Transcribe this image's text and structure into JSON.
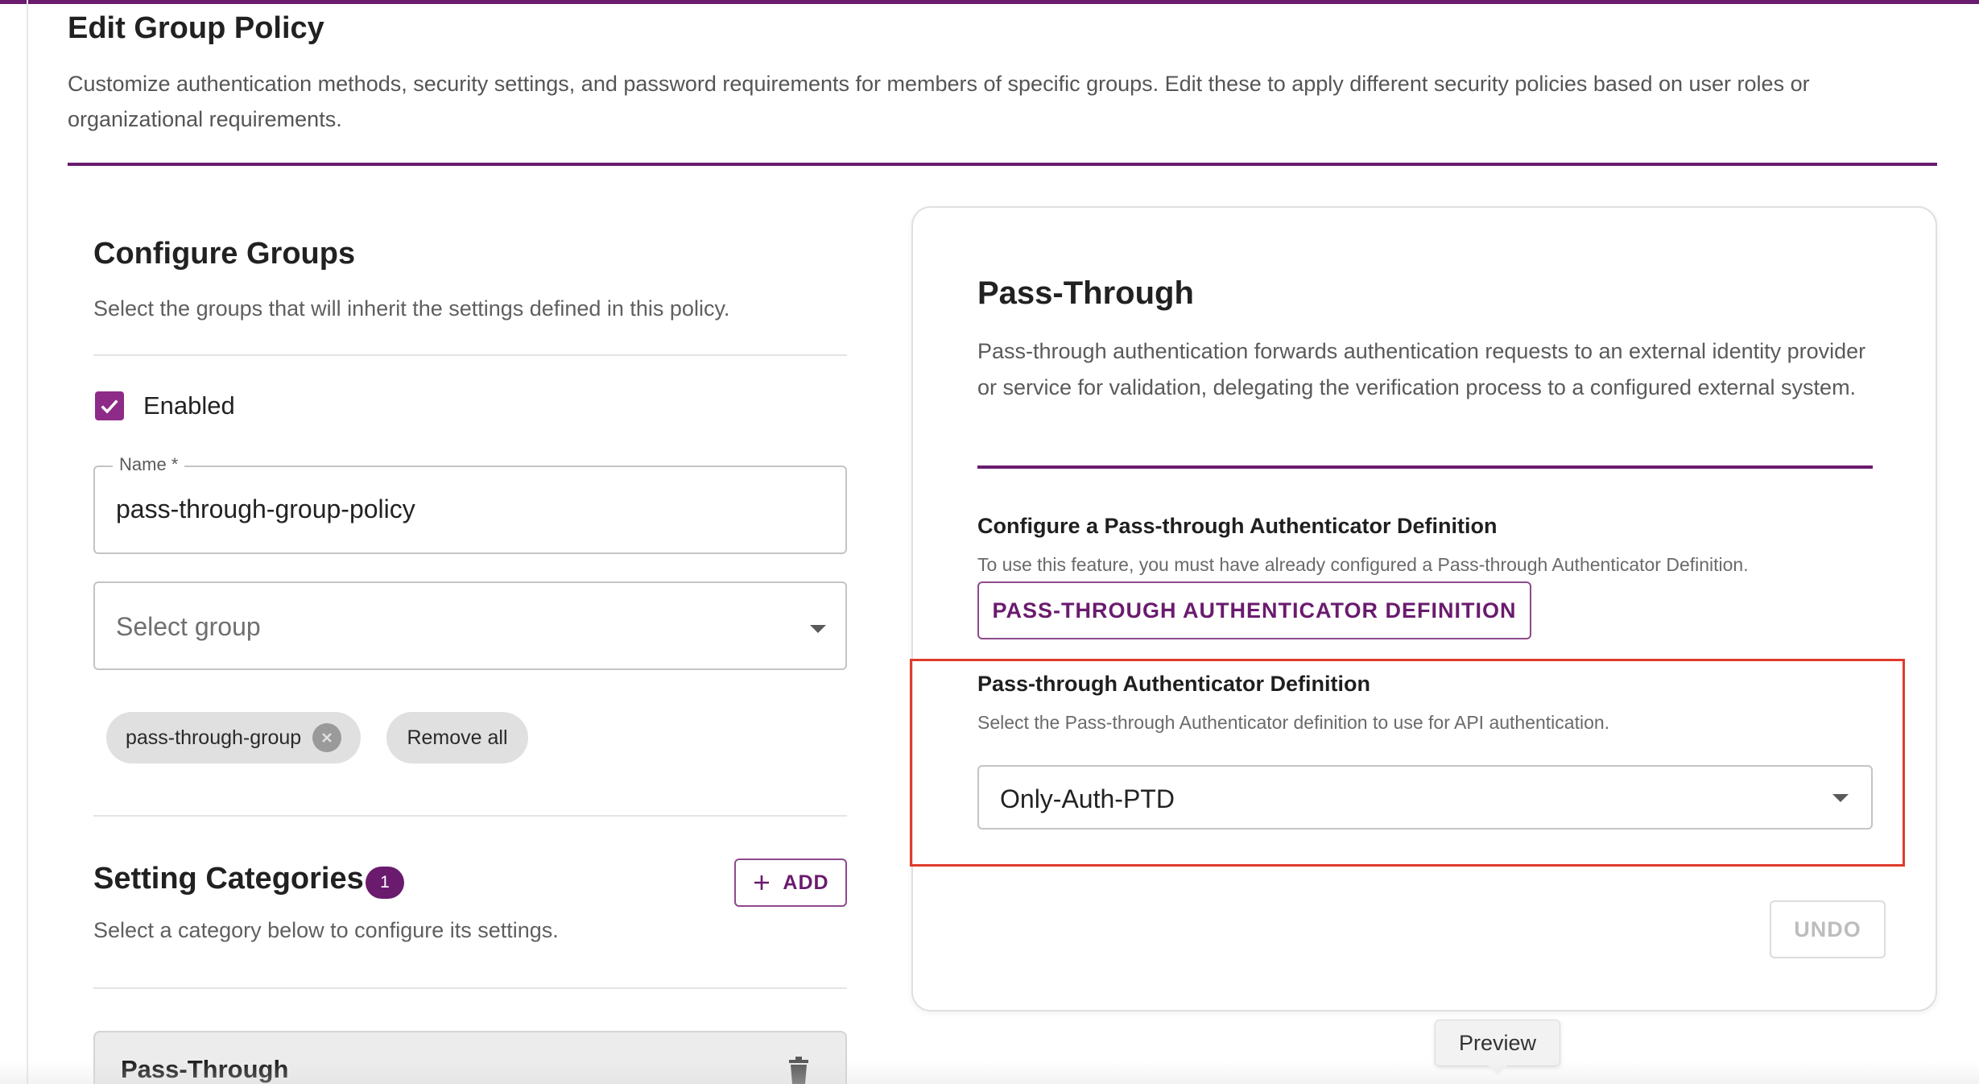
{
  "header": {
    "title": "Edit Group Policy",
    "description": "Customize authentication methods, security settings, and password requirements for members of specific groups. Edit these to apply different security policies based on user roles or organizational requirements."
  },
  "configure_groups": {
    "title": "Configure Groups",
    "description": "Select the groups that will inherit the settings defined in this policy.",
    "enabled_label": "Enabled",
    "enabled": true,
    "name_field": {
      "label": "Name *",
      "value": "pass-through-group-policy"
    },
    "group_select": {
      "placeholder": "Select group"
    },
    "chips": [
      {
        "label": "pass-through-group"
      }
    ],
    "remove_all_label": "Remove all"
  },
  "setting_categories": {
    "title": "Setting Categories",
    "count": "1",
    "add_label": "ADD",
    "description": "Select a category below to configure its settings.",
    "items": [
      {
        "label": "Pass-Through"
      }
    ]
  },
  "pass_through": {
    "title": "Pass-Through",
    "description": "Pass-through authentication forwards authentication requests to an external identity provider or service for validation, delegating the verification process to a configured external system.",
    "configure_title": "Configure a Pass-through Authenticator Definition",
    "configure_desc": "To use this feature, you must have already configured a Pass-through Authenticator Definition.",
    "definition_button": "PASS-THROUGH AUTHENTICATOR DEFINITION",
    "select_title": "Pass-through Authenticator Definition",
    "select_desc": "Select the Pass-through Authenticator definition to use for API authentication.",
    "select_value": "Only-Auth-PTD",
    "undo_label": "UNDO"
  },
  "tooltip": {
    "text": "Preview"
  },
  "colors": {
    "accent": "#6a1b6e",
    "checkbox": "#8e2a87",
    "highlight": "#e03b2b"
  }
}
